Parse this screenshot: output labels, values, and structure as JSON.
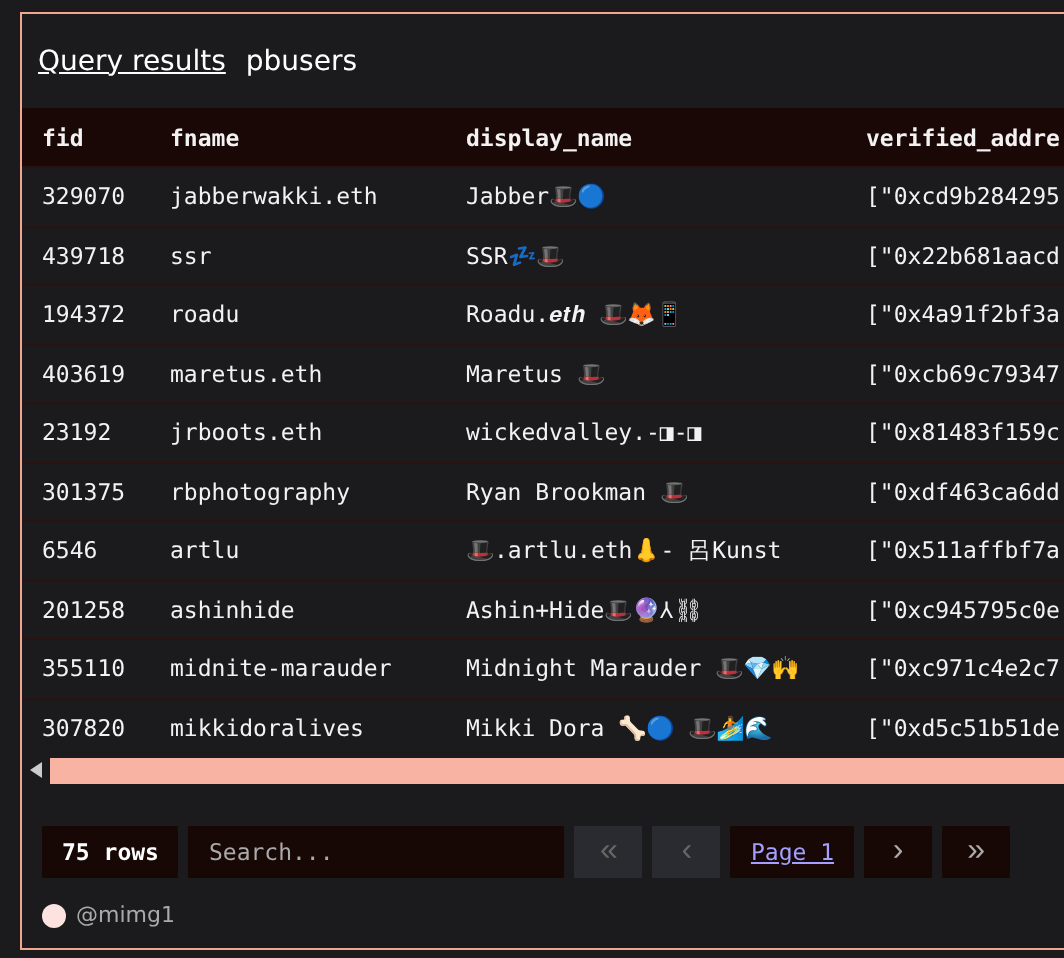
{
  "header": {
    "title": "Query results",
    "subtitle": "pbusers"
  },
  "table": {
    "columns": [
      "fid",
      "fname",
      "display_name",
      "verified_addre"
    ],
    "rows": [
      [
        "329070",
        "jabberwakki.eth",
        "Jabber🎩🔵",
        "[\"0xcd9b284295"
      ],
      [
        "439718",
        "ssr",
        "SSR💤🎩",
        "[\"0x22b681aacd"
      ],
      [
        "194372",
        "roadu",
        "Roadu.𝒆𝒕𝒉 🎩🦊📱",
        "[\"0x4a91f2bf3a"
      ],
      [
        "403619",
        "maretus.eth",
        "Maretus 🎩",
        "[\"0xcb69c79347"
      ],
      [
        "23192",
        "jrboots.eth",
        "wickedvalley.-◨-◨",
        "[\"0x81483f159c"
      ],
      [
        "301375",
        "rbphotography",
        "Ryan Brookman 🎩",
        "[\"0xdf463ca6dd"
      ],
      [
        "6546",
        "artlu",
        "🎩.artlu.eth👃- 呂Kunst",
        "[\"0x511affbf7a"
      ],
      [
        "201258",
        "ashinhide",
        "Ashin+Hide🎩🔮⅄⛓",
        "[\"0xc945795c0e"
      ],
      [
        "355110",
        "midnite-marauder",
        "Midnight Marauder 🎩💎🙌",
        "[\"0xc971c4e2c7"
      ],
      [
        "307820",
        "mikkidoralives",
        "Mikki Dora 🦴🔵 🎩🏄🌊",
        "[\"0xd5c51b51de"
      ]
    ]
  },
  "footer": {
    "row_count": "75 rows",
    "search": {
      "placeholder": "Search..."
    },
    "pager": [
      {
        "kind": "first",
        "label": "«",
        "disabled": true
      },
      {
        "kind": "prev",
        "label": "‹",
        "disabled": true
      },
      {
        "kind": "page",
        "label": "Page 1",
        "disabled": false
      },
      {
        "kind": "next",
        "label": "›",
        "disabled": false
      },
      {
        "kind": "last",
        "label": "»",
        "disabled": false
      }
    ]
  },
  "user": {
    "handle": "@mimg1"
  }
}
